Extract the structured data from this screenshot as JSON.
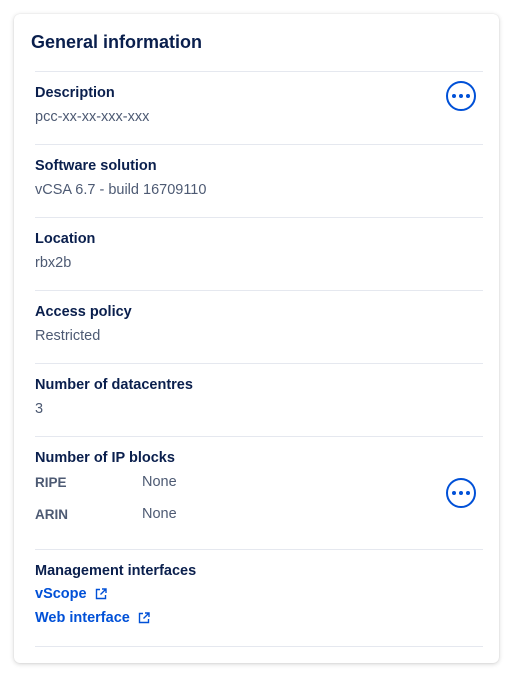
{
  "card": {
    "title": "General information"
  },
  "description": {
    "label": "Description",
    "value": "pcc-xx-xx-xxx-xxx",
    "action_icon": "more-icon"
  },
  "software": {
    "label": "Software solution",
    "value": "vCSA 6.7 - build 16709110"
  },
  "location": {
    "label": "Location",
    "value": "rbx2b"
  },
  "access_policy": {
    "label": "Access policy",
    "value": "Restricted"
  },
  "datacentres": {
    "label": "Number of datacentres",
    "value": "3"
  },
  "ip_blocks": {
    "label": "Number of IP blocks",
    "rows": [
      {
        "name": "RIPE",
        "value": "None"
      },
      {
        "name": "ARIN",
        "value": "None"
      }
    ],
    "action_icon": "more-icon"
  },
  "management": {
    "label": "Management interfaces",
    "links": [
      {
        "label": "vScope",
        "icon": "external-link-icon"
      },
      {
        "label": "Web interface",
        "icon": "external-link-icon"
      }
    ]
  },
  "colors": {
    "heading": "#0a1f4d",
    "text": "#4d5a73",
    "accent": "#0050d7",
    "divider": "#e5e8ef"
  }
}
